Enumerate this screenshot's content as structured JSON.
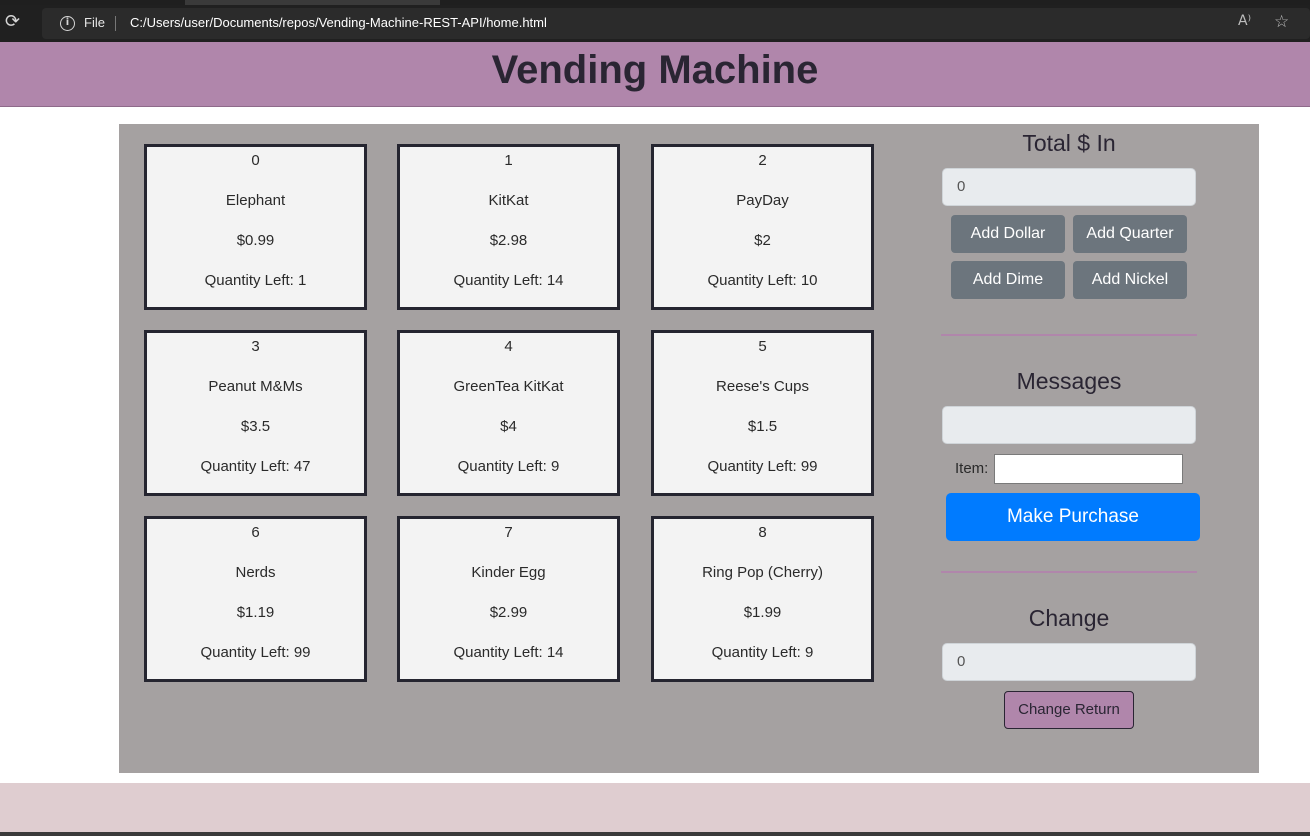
{
  "browser": {
    "file_label": "File",
    "url": "C:/Users/user/Documents/repos/Vending-Machine-REST-API/home.html",
    "icons": {
      "reload": "reload-icon",
      "info": "info-icon",
      "read_aloud": "read-aloud-icon",
      "favorites": "favorites-icon"
    }
  },
  "header": {
    "title": "Vending Machine"
  },
  "items": [
    {
      "id": "0",
      "name": "Elephant",
      "price": "$0.99",
      "quantity": "Quantity Left: 1"
    },
    {
      "id": "1",
      "name": "KitKat",
      "price": "$2.98",
      "quantity": "Quantity Left: 14"
    },
    {
      "id": "2",
      "name": "PayDay",
      "price": "$2",
      "quantity": "Quantity Left: 10"
    },
    {
      "id": "3",
      "name": "Peanut M&Ms",
      "price": "$3.5",
      "quantity": "Quantity Left: 47"
    },
    {
      "id": "4",
      "name": "GreenTea KitKat",
      "price": "$4",
      "quantity": "Quantity Left: 9"
    },
    {
      "id": "5",
      "name": "Reese's Cups",
      "price": "$1.5",
      "quantity": "Quantity Left: 99"
    },
    {
      "id": "6",
      "name": "Nerds",
      "price": "$1.19",
      "quantity": "Quantity Left: 99"
    },
    {
      "id": "7",
      "name": "Kinder Egg",
      "price": "$2.99",
      "quantity": "Quantity Left: 14"
    },
    {
      "id": "8",
      "name": "Ring Pop (Cherry)",
      "price": "$1.99",
      "quantity": "Quantity Left: 9"
    }
  ],
  "money": {
    "title": "Total $ In",
    "value": "0",
    "add_dollar": "Add Dollar",
    "add_quarter": "Add Quarter",
    "add_dime": "Add Dime",
    "add_nickel": "Add Nickel"
  },
  "messages": {
    "title": "Messages",
    "value": "",
    "item_label": "Item:",
    "item_value": "",
    "purchase_button": "Make Purchase"
  },
  "change": {
    "title": "Change",
    "value": "0",
    "return_button": "Change Return"
  },
  "colors": {
    "header_bg": "#b086ab",
    "panel_bg": "#a5a1a1",
    "primary": "#007bff",
    "secondary": "#6c757d",
    "footer_bg": "#dfcdd0"
  }
}
